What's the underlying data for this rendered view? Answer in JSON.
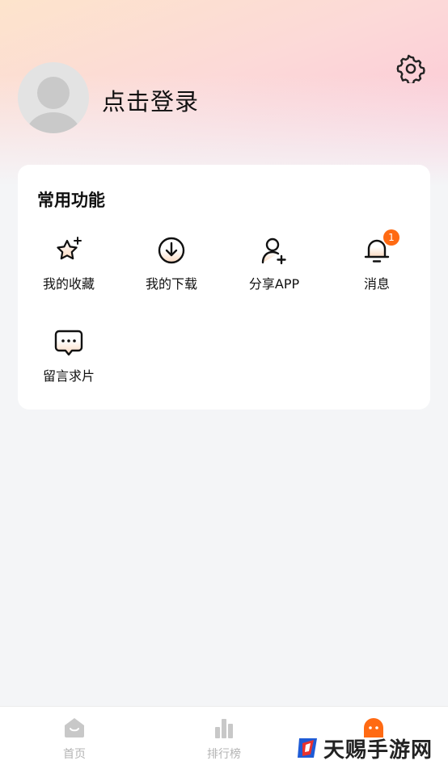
{
  "profile": {
    "login_label": "点击登录",
    "avatar_icon": "default-avatar-icon",
    "settings_icon": "gear-icon"
  },
  "functions": {
    "title": "常用功能",
    "items": [
      {
        "label": "我的收藏",
        "icon": "star-sparkle-icon"
      },
      {
        "label": "我的下载",
        "icon": "download-icon"
      },
      {
        "label": "分享APP",
        "icon": "add-user-icon"
      },
      {
        "label": "消息",
        "icon": "bell-icon",
        "badge": "1"
      },
      {
        "label": "留言求片",
        "icon": "message-bubble-icon"
      }
    ]
  },
  "tabbar": {
    "tabs": [
      {
        "label": "首页",
        "icon": "home-icon"
      },
      {
        "label": "排行榜",
        "icon": "bar-chart-icon"
      },
      {
        "label": "",
        "icon": "mascot-icon",
        "active": true
      }
    ]
  },
  "watermark": {
    "text": "天赐手游网"
  },
  "colors": {
    "accent": "#ff6a13",
    "tab_inactive": "#b4b4b4",
    "background": "#f4f5f7"
  }
}
